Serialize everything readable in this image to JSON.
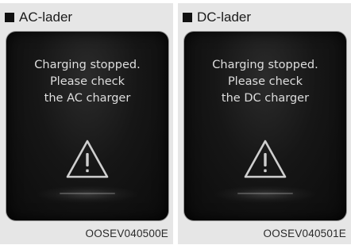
{
  "panels": [
    {
      "title": "AC-lader",
      "lines": [
        "Charging stopped.",
        "Please check",
        "the AC charger"
      ],
      "icon": "warning-triangle-icon",
      "code": "OOSEV040500E"
    },
    {
      "title": "DC-lader",
      "lines": [
        "Charging stopped.",
        "Please check",
        "the DC charger"
      ],
      "icon": "warning-triangle-icon",
      "code": "OOSEV040501E"
    }
  ],
  "colors": {
    "background": "#e6e6e6",
    "screen": "#141414",
    "text": "#dedede"
  }
}
